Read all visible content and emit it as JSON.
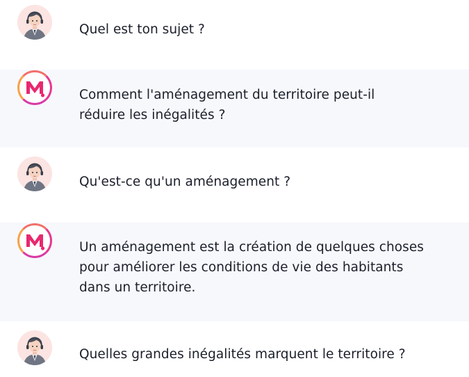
{
  "messages": [
    {
      "role": "user",
      "avatar_icon": "student-avatar-icon",
      "lines": [
        "Quel est ton sujet ?"
      ]
    },
    {
      "role": "assistant",
      "avatar_icon": "m-logo-icon",
      "lines": [
        "Comment l'aménagement du territoire peut-il",
        "réduire les inégalités ?"
      ]
    },
    {
      "role": "user",
      "avatar_icon": "student-avatar-icon",
      "lines": [
        "Qu'est-ce qu'un aménagement ?"
      ]
    },
    {
      "role": "assistant",
      "avatar_icon": "m-logo-icon",
      "lines": [
        "Un aménagement est la création de quelques choses",
        "pour améliorer les conditions de vie des habitants",
        "dans un territoire."
      ]
    },
    {
      "role": "user",
      "avatar_icon": "student-avatar-icon",
      "lines": [
        "Quelles grandes inégalités marquent le territoire ?"
      ]
    }
  ],
  "colors": {
    "assistant_row_bg": "#f7f8fc",
    "user_row_bg": "#ffffff",
    "logo_gradient_start": "#f7a24b",
    "logo_gradient_end": "#e0217f",
    "text": "#1b1f2a"
  }
}
